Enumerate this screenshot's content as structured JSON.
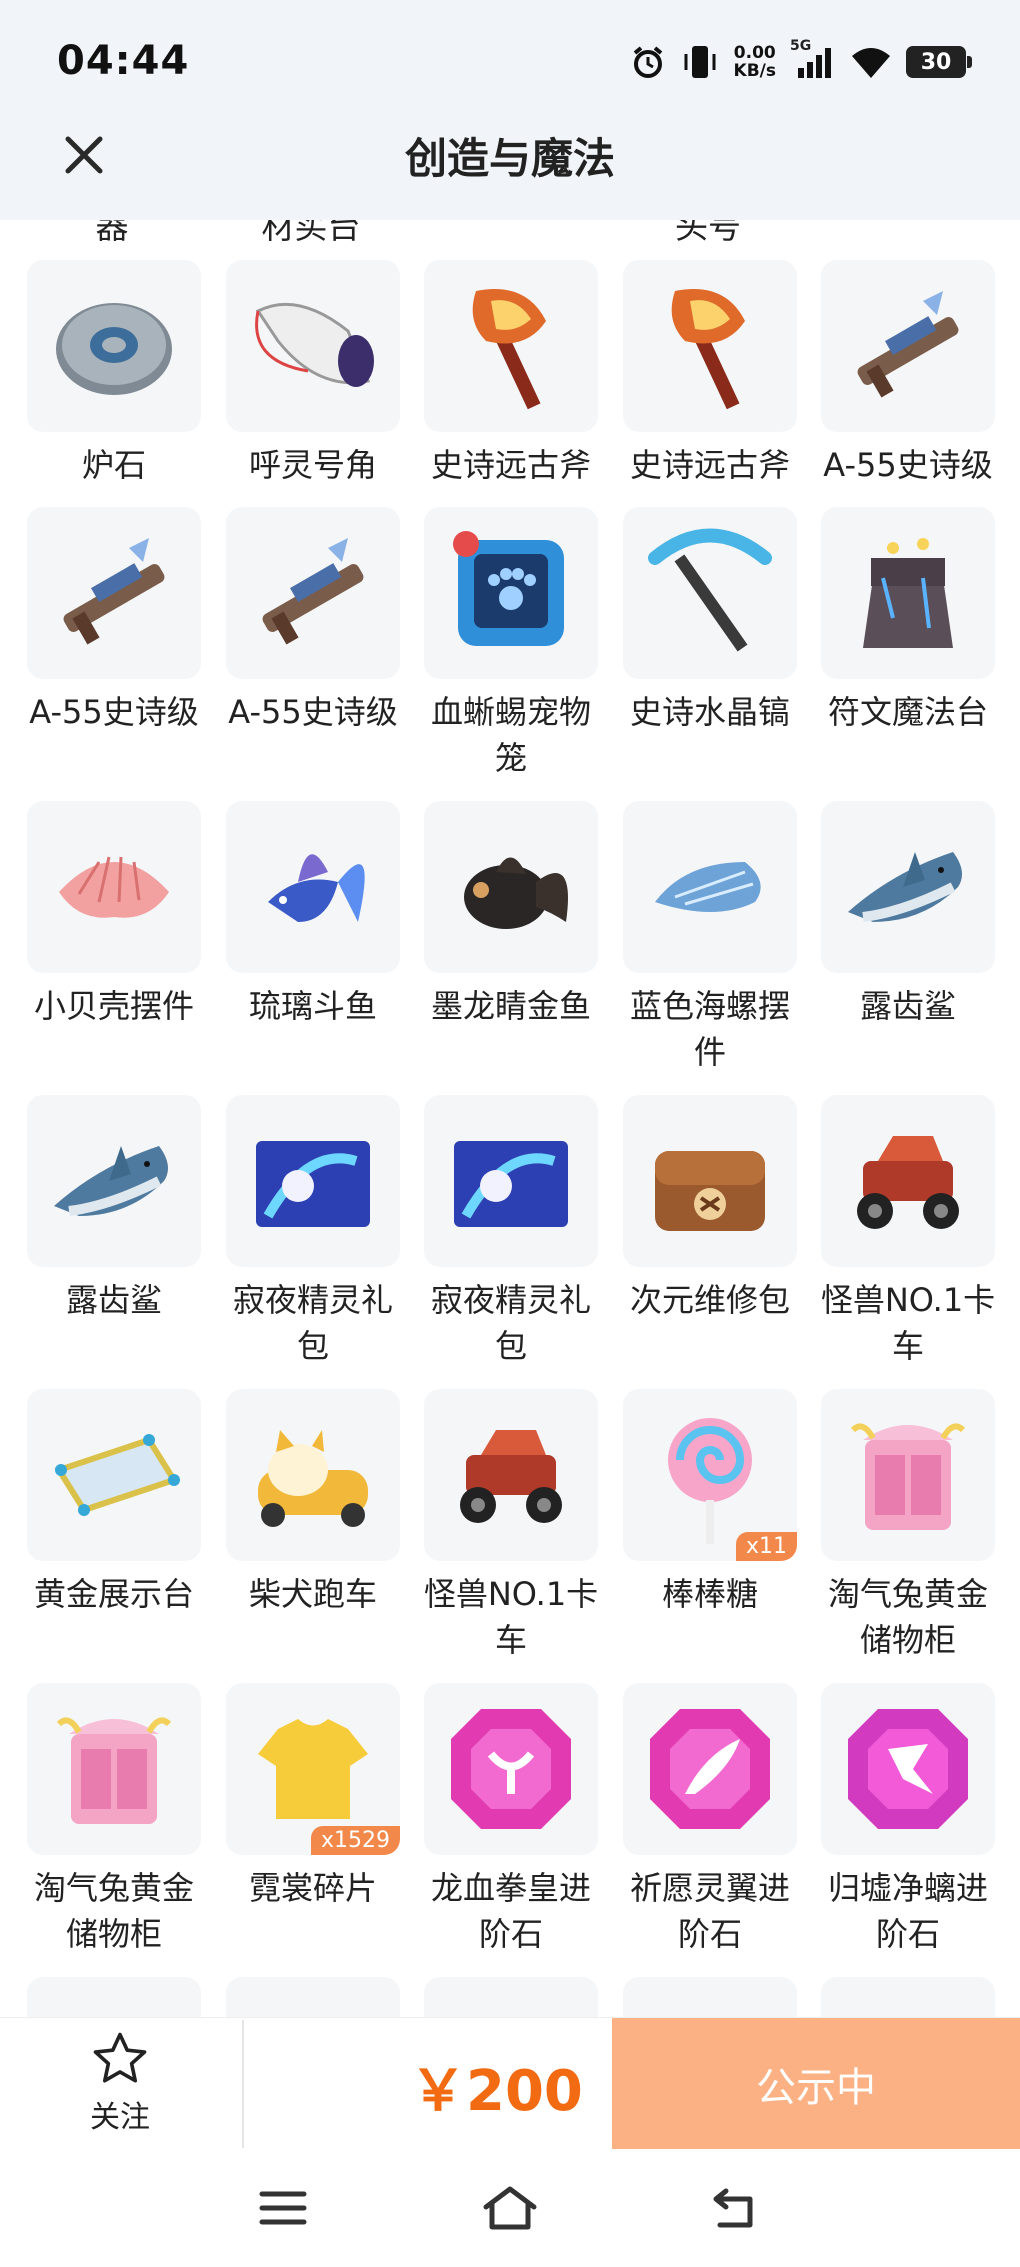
{
  "status_bar": {
    "time": "04:44",
    "net_speed_value": "0.00",
    "net_speed_unit": "KB/s",
    "network": "5G",
    "battery": "30"
  },
  "header": {
    "title": "创造与魔法"
  },
  "cut_row_labels": [
    "器",
    "材买台",
    "",
    "头号",
    ""
  ],
  "items": [
    {
      "label": "炉石",
      "icon": "stone-icon"
    },
    {
      "label": "呼灵号角",
      "icon": "horn-icon"
    },
    {
      "label": "史诗远古斧",
      "icon": "axe-icon"
    },
    {
      "label": "史诗远古斧",
      "icon": "axe-icon"
    },
    {
      "label": "A-55史诗级",
      "icon": "rifle-icon"
    },
    {
      "label": "A-55史诗级",
      "icon": "rifle-icon"
    },
    {
      "label": "A-55史诗级",
      "icon": "rifle-icon"
    },
    {
      "label": "血蜥蜴宠物笼",
      "icon": "pet-cage-icon"
    },
    {
      "label": "史诗水晶镐",
      "icon": "pickaxe-icon"
    },
    {
      "label": "符文魔法台",
      "icon": "rune-table-icon"
    },
    {
      "label": "小贝壳摆件",
      "icon": "shell-icon"
    },
    {
      "label": "琉璃斗鱼",
      "icon": "betta-fish-icon"
    },
    {
      "label": "墨龙睛金鱼",
      "icon": "goldfish-icon"
    },
    {
      "label": "蓝色海螺摆件",
      "icon": "conch-icon"
    },
    {
      "label": "露齿鲨",
      "icon": "shark-icon"
    },
    {
      "label": "露齿鲨",
      "icon": "shark-icon"
    },
    {
      "label": "寂夜精灵礼包",
      "icon": "gift-box-icon"
    },
    {
      "label": "寂夜精灵礼包",
      "icon": "gift-box-icon"
    },
    {
      "label": "次元维修包",
      "icon": "repair-bag-icon"
    },
    {
      "label": "怪兽NO.1卡车",
      "icon": "monster-truck-icon"
    },
    {
      "label": "黄金展示台",
      "icon": "display-stand-icon"
    },
    {
      "label": "柴犬跑车",
      "icon": "shiba-car-icon"
    },
    {
      "label": "怪兽NO.1卡车",
      "icon": "monster-truck-icon"
    },
    {
      "label": "棒棒糖",
      "icon": "lollipop-icon",
      "badge": "x11"
    },
    {
      "label": "淘气兔黄金储物柜",
      "icon": "cabinet-icon"
    },
    {
      "label": "淘气兔黄金储物柜",
      "icon": "cabinet-icon"
    },
    {
      "label": "霓裳碎片",
      "icon": "shirt-fragment-icon",
      "badge": "x1529"
    },
    {
      "label": "龙血拳皇进阶石",
      "icon": "gem-bull-icon"
    },
    {
      "label": "祈愿灵翼进阶石",
      "icon": "gem-wing-icon"
    },
    {
      "label": "归墟净螭进阶石",
      "icon": "gem-claw-icon"
    }
  ],
  "bottom_bar": {
    "follow_label": "关注",
    "price": "￥200",
    "status_button": "公示中"
  },
  "colors": {
    "accent": "#f26a12",
    "button": "#fbb183",
    "header_bg": "#f1f4f8",
    "card_bg": "#f5f6f8"
  }
}
